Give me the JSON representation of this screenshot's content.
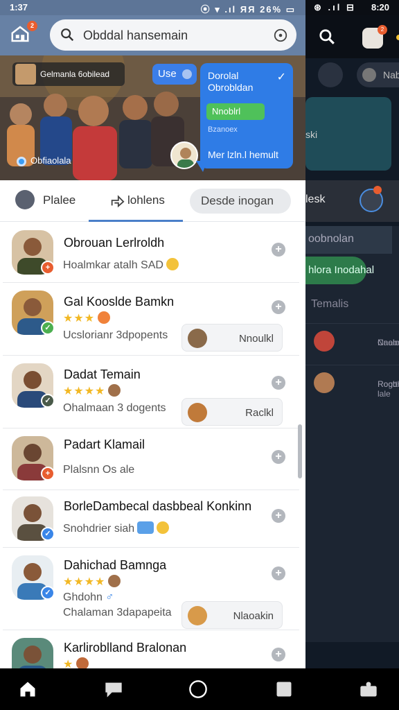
{
  "status_left": {
    "time": "1:37",
    "icons": "⦿ ▾ .ıl ЯЯ 26% ▭"
  },
  "status_right": {
    "icons": "⊛ .ıl ⊟",
    "time": "8:20"
  },
  "topbar": {
    "home_badge": "2",
    "search_text": "Obddal hansemain"
  },
  "hero": {
    "tag_label": "Gelmanla 6obilead",
    "chip_label": "Use",
    "bottom_label": "Obfiaolala",
    "bubble": {
      "title_line1": "Dorolal",
      "title_line2": "Obrobldan",
      "green_label": "Nnoblrl",
      "small_label": "Bzanoex",
      "bottom_label": "Mer lzln.l hemult"
    }
  },
  "tabs": [
    {
      "label": "Plalee"
    },
    {
      "label": "lohlens"
    },
    {
      "label": "Desde inogan"
    }
  ],
  "rows": [
    {
      "name": "Obrouan Lerlroldh",
      "sub": "Hoalmkar atalh SAD",
      "badge": "+"
    },
    {
      "name": "Gal Kooslde Bamkn",
      "stars": "★★★",
      "sub": "Ucslorianr 3dpopents",
      "pill": "Nnoulkl",
      "badge": "✓"
    },
    {
      "name": "Dadat Temain",
      "stars": "★★★★",
      "sub": "Ohalmaan 3 dogents",
      "pill": "Raclkl",
      "badge": "✓"
    },
    {
      "name": "Padart Klamail",
      "sub": "Plalsnn Os ale",
      "badge": "+"
    },
    {
      "name": "BorleDambecal dasbbeal Konkinn",
      "sub": "Snohdrier siah",
      "badge": "✓"
    },
    {
      "name": "Dahichad Bamnga",
      "stars": "★★★★",
      "sub": "Ghdohn",
      "sub2": "Chalaman 3dapapeita",
      "pill": "Nlaoakin",
      "badge": "✓"
    },
    {
      "name": "Karliroblland Bralonan",
      "stars": "★"
    }
  ],
  "right": {
    "badge": "2",
    "chip_label": "Nab",
    "card_label": "ski",
    "tabs_label": "lesk",
    "item1": "oobnolan",
    "green": "hlora Inodahal",
    "temas": "Temalis",
    "row1_line1": "Naabnaa",
    "row1_line2": "Cnoloolas",
    "row2_line1": "Rogbr",
    "row2_line2": "Roottlel-lale"
  },
  "colors": {
    "accent": "#2f7ce6",
    "green": "#4fc15a",
    "badge": "#e85d2f",
    "star": "#f2b824"
  }
}
